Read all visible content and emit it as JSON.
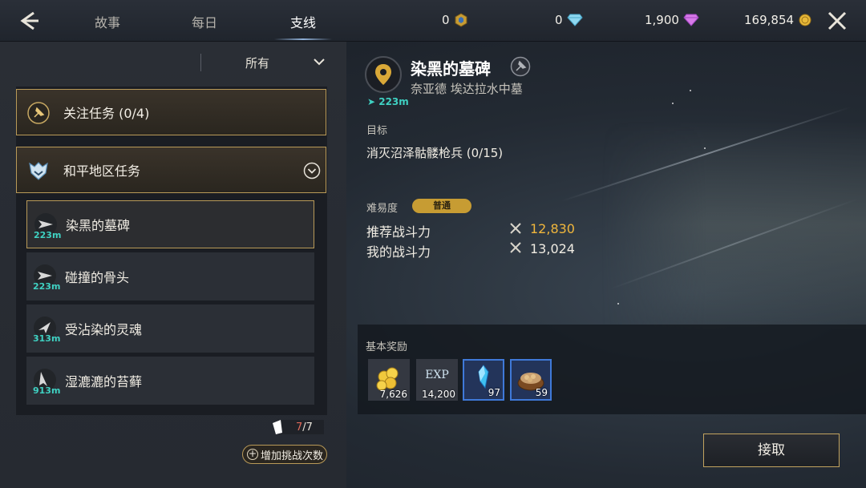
{
  "tabs": [
    {
      "label": "故事",
      "active": false
    },
    {
      "label": "每日",
      "active": false
    },
    {
      "label": "支线",
      "active": true
    }
  ],
  "currencies": [
    {
      "value": "0",
      "icon": "hex-token-icon"
    },
    {
      "value": "0",
      "icon": "diamond-icon"
    },
    {
      "value": "1,900",
      "icon": "purple-gem-icon"
    },
    {
      "value": "169,854",
      "icon": "gold-coin-icon"
    }
  ],
  "filter": {
    "selected": "所有"
  },
  "categories": [
    {
      "label": "关注任务 (0/4)",
      "icon": "pin-icon"
    },
    {
      "label": "和平地区任务",
      "icon": "helmet-icon"
    }
  ],
  "quests": [
    {
      "name": "染黑的墓碑",
      "distance": "223m",
      "selected": true
    },
    {
      "name": "碰撞的骨头",
      "distance": "223m",
      "selected": false
    },
    {
      "name": "受沾染的灵魂",
      "distance": "313m",
      "selected": false
    },
    {
      "name": "湿漉漉的苔藓",
      "distance": "913m",
      "selected": false
    }
  ],
  "challenge": {
    "current": "7",
    "sep_total": "/7",
    "add_label": "增加挑战次数"
  },
  "detail": {
    "distance": "223m",
    "title": "染黑的墓碑",
    "location": "奈亚德 埃达拉水中墓",
    "objective_label": "目标",
    "objective": "消灭沼泽骷髅枪兵   (0/15)",
    "difficulty_label": "难易度",
    "difficulty": "普通",
    "recommended_label": "推荐战斗力",
    "recommended_value": "12,830",
    "my_label": "我的战斗力",
    "my_value": "13,024",
    "colors": {
      "recommended": "#f0b63c",
      "my": "#f0ece3",
      "accent_gold": "#b99a58"
    }
  },
  "rewards": {
    "title": "基本奖励",
    "items": [
      {
        "amount": "7,626",
        "icon": "gold-coins-icon"
      },
      {
        "amount": "14,200",
        "icon": "exp-icon",
        "text": "EXP"
      },
      {
        "amount": "97",
        "icon": "blue-crystal-icon"
      },
      {
        "amount": "59",
        "icon": "nut-bowl-icon"
      }
    ]
  },
  "accept_label": "接取"
}
